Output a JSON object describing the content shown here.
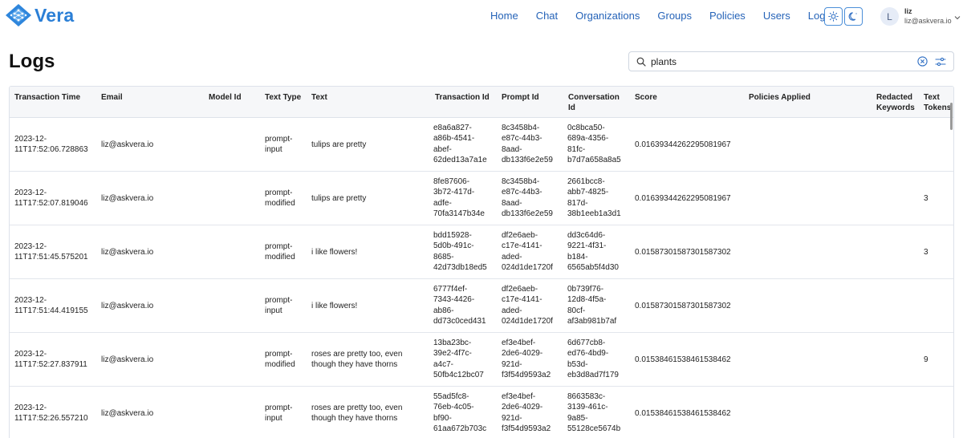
{
  "brand": {
    "name": "Vera"
  },
  "nav": {
    "items": [
      "Home",
      "Chat",
      "Organizations",
      "Groups",
      "Policies",
      "Users",
      "Logs"
    ]
  },
  "user": {
    "initial": "L",
    "name": "liz",
    "email": "liz@askvera.io"
  },
  "page": {
    "title": "Logs"
  },
  "search": {
    "value": "plants",
    "placeholder": ""
  },
  "table": {
    "columns": [
      "Transaction Time",
      "Email",
      "Model Id",
      "Text Type",
      "Text",
      "Transaction Id",
      "Prompt Id",
      "Conversation Id",
      "Score",
      "Policies Applied",
      "Redacted Keywords",
      "Text Tokens"
    ],
    "rows": [
      {
        "time": "2023-12-\n11T17:52:06.728863",
        "email": "liz@askvera.io",
        "model": "",
        "type": "prompt-\ninput",
        "text": "tulips are pretty",
        "tx": "e8a6a827-\na86b-4541-\nabef-\n62ded13a7a1e",
        "prompt": "8c3458b4-\ne87c-44b3-\n8aad-\ndb133f6e2e59",
        "conv": "0c8bca50-\n689a-4356-\n81fc-\nb7d7a658a8a5",
        "score": "0.01639344262295081967",
        "policies": "",
        "redacted": "",
        "tokens": ""
      },
      {
        "time": "2023-12-\n11T17:52:07.819046",
        "email": "liz@askvera.io",
        "model": "",
        "type": "prompt-\nmodified",
        "text": "tulips are pretty",
        "tx": "8fe87606-\n3b72-417d-\nadfe-\n70fa3147b34e",
        "prompt": "8c3458b4-\ne87c-44b3-\n8aad-\ndb133f6e2e59",
        "conv": "2661bcc8-\nabb7-4825-\n817d-\n38b1eeb1a3d1",
        "score": "0.01639344262295081967",
        "policies": "",
        "redacted": "",
        "tokens": "3"
      },
      {
        "time": "2023-12-\n11T17:51:45.575201",
        "email": "liz@askvera.io",
        "model": "",
        "type": "prompt-\nmodified",
        "text": "i like flowers!",
        "tx": "bdd15928-\n5d0b-491c-\n8685-\n42d73db18ed5",
        "prompt": "df2e6aeb-\nc17e-4141-\naded-\n024d1de1720f",
        "conv": "dd3c64d6-\n9221-4f31-\nb184-\n6565ab5f4d30",
        "score": "0.01587301587301587302",
        "policies": "",
        "redacted": "",
        "tokens": "3"
      },
      {
        "time": "2023-12-\n11T17:51:44.419155",
        "email": "liz@askvera.io",
        "model": "",
        "type": "prompt-\ninput",
        "text": "i like flowers!",
        "tx": "6777f4ef-\n7343-4426-\nab86-\ndd73c0ced431",
        "prompt": "df2e6aeb-\nc17e-4141-\naded-\n024d1de1720f",
        "conv": "0b739f76-\n12d8-4f5a-\n80cf-\naf3ab981b7af",
        "score": "0.01587301587301587302",
        "policies": "",
        "redacted": "",
        "tokens": ""
      },
      {
        "time": "2023-12-\n11T17:52:27.837911",
        "email": "liz@askvera.io",
        "model": "",
        "type": "prompt-\nmodified",
        "text": "roses are pretty too, even\nthough they have thorns",
        "tx": "13ba23bc-\n39e2-4f7c-\na4c7-\n50fb4c12bc07",
        "prompt": "ef3e4bef-\n2de6-4029-\n921d-\nf3f54d9593a2",
        "conv": "6d677cb8-\ned76-4bd9-\nb53d-\neb3d8ad7f179",
        "score": "0.01538461538461538462",
        "policies": "",
        "redacted": "",
        "tokens": "9"
      },
      {
        "time": "2023-12-\n11T17:52:26.557210",
        "email": "liz@askvera.io",
        "model": "",
        "type": "prompt-\ninput",
        "text": "roses are pretty too, even\nthough they have thorns",
        "tx": "55ad5fc8-\n76eb-4c05-\nbf90-\n61aa672b703c",
        "prompt": "ef3e4bef-\n2de6-4029-\n921d-\nf3f54d9593a2",
        "conv": "8663583c-\n3139-461c-\n9a85-\n55128ce5674b",
        "score": "0.01538461538461538462",
        "policies": "",
        "redacted": "",
        "tokens": ""
      }
    ]
  },
  "colors": {
    "accent": "#2563b8",
    "logo": "#2b7fd6",
    "border": "#dde2ea"
  },
  "icons": [
    "vera-logo-icon",
    "sun-icon",
    "moon-icon",
    "chevron-down-icon",
    "search-icon",
    "clear-icon",
    "filter-icon"
  ]
}
